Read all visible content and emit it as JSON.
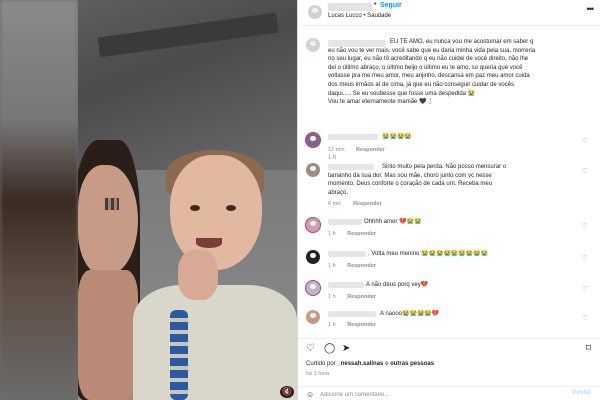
{
  "header": {
    "location": "Lucas Lucco • Saudade",
    "follow_label": "Seguir",
    "dot": "•",
    "more": "•••"
  },
  "caption": {
    "text": "EU TE AMO, eu nunca vou me acostumar em saber q eu não vou te ver mais, você sabe que eu daria minha vida pela sua, morreria no seu lugar, eu não tô acreditando q eu não cuidei de você direito, não lhe dei o último abraço, o último beijo o último eu te amo, so queria que você voltasse pra me meu amor, meu anjinho, descansa em paz meu amor cuida dos meus irmãos aí de cima, já que eu não conseguir cuidar de vocês daqui..... Se eu soubesse que fosse uma despedida 😭\nVou te amar eternamente mamãe 🖤🕯️",
    "time": "1 h"
  },
  "comments": [
    {
      "text": "😭😭😭😭",
      "time": "12 min",
      "reply": "Responder"
    },
    {
      "text": "Sinto muito pela perda. Não posso mensurar o tamanho da sua dor. Mas sou mãe, choro junto com vc nesse momento. Deus conforte o coração de cada um. Receba meu abraço.",
      "time": "6 min",
      "reply": "Responder"
    },
    {
      "text": "Ohhhh amor 💔😭😭",
      "time": "1 h",
      "reply": "Responder"
    },
    {
      "text": ". Volta meu menino 😭😭😭😭😭😭😭😭😭",
      "time": "1 h",
      "reply": "Responder"
    },
    {
      "text": "A não deus porq vey💔",
      "time": "1 h",
      "reply": "Responder"
    },
    {
      "text": "A naooo😭😭😭😭💔",
      "time": "1 h",
      "reply": "Responder"
    }
  ],
  "actions": {
    "liked_prefix": "Curtido por",
    "liked_user": "_nessah.salinas",
    "liked_suffix": "e",
    "liked_others": "outras pessoas",
    "time": "há 1 hora"
  },
  "add_comment": {
    "placeholder": "Adicione um comentário...",
    "post_label": "Postar"
  },
  "icons": {
    "heart": "♡",
    "comment": "◯",
    "share": "➤",
    "bookmark": "⌑",
    "emoji": "☺",
    "sound": "🔇"
  }
}
